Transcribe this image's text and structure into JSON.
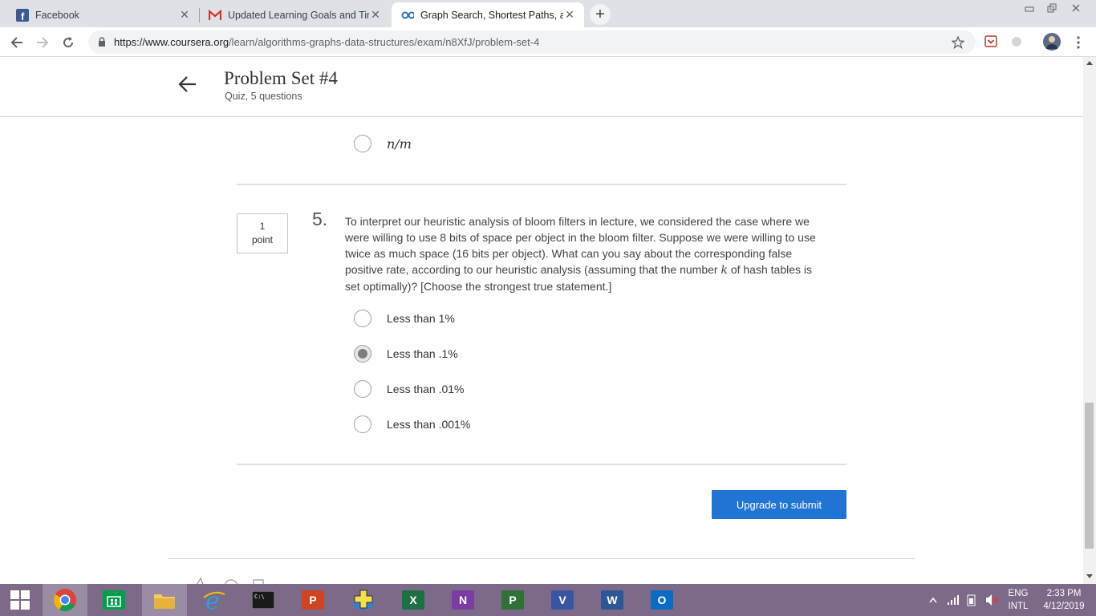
{
  "browser": {
    "tabs": [
      {
        "title": "Facebook",
        "active": false
      },
      {
        "title": "Updated Learning Goals and Tim",
        "active": false
      },
      {
        "title": "Graph Search, Shortest Paths, and",
        "active": true
      }
    ],
    "new_tab_symbol": "+",
    "close_symbol": "✕",
    "url_host": "https://www.coursera.org",
    "url_path": "/learn/algorithms-graphs-data-structures/exam/n8XfJ/problem-set-4"
  },
  "quiz": {
    "title": "Problem Set #4",
    "subtitle": "Quiz, 5 questions"
  },
  "prev_option": {
    "label": "n/m",
    "selected": false
  },
  "question": {
    "points_value": "1",
    "points_unit": "point",
    "number": "5.",
    "text_before_k": "To interpret our heuristic analysis of bloom filters in lecture, we considered the case where we were willing to use 8 bits of space per object in the bloom filter. Suppose we were willing to use twice as much space (16 bits per object). What can you say about the corresponding false positive rate, according to our heuristic analysis (assuming that the number ",
    "k_symbol": "k",
    "text_after_k": " of hash tables is set optimally)? [Choose the strongest true statement.]",
    "options": [
      {
        "label": "Less than 1%",
        "selected": false
      },
      {
        "label": "Less than .1%",
        "selected": true
      },
      {
        "label": "Less than .01%",
        "selected": false
      },
      {
        "label": "Less than .001%",
        "selected": false
      }
    ]
  },
  "submit_label": "Upgrade to submit",
  "taskbar": {
    "apps": [
      "start",
      "chrome",
      "store",
      "file-explorer",
      "internet-explorer",
      "command-prompt",
      "powerpoint",
      "game-app",
      "excel",
      "onenote",
      "project",
      "visio",
      "word",
      "outlook"
    ],
    "app_letters": {
      "powerpoint": "P",
      "excel": "X",
      "onenote": "N",
      "project": "P",
      "visio": "V",
      "word": "W",
      "outlook": "O"
    },
    "lang": "ENG",
    "layout": "INTL",
    "time": "2:33 PM",
    "date": "4/12/2019"
  },
  "colors": {
    "accent": "#1f74d4",
    "taskbar": "#7c6a88",
    "tabstrip": "#dee1e6"
  }
}
